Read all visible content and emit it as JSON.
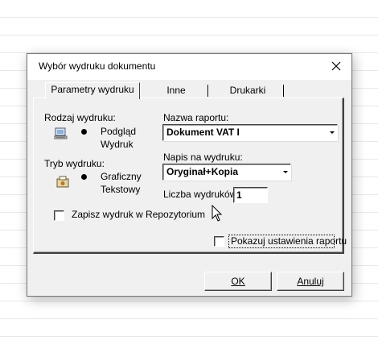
{
  "window": {
    "title": "Wybór wydruku dokumentu"
  },
  "tabs": [
    {
      "label": "Parametry wydruku",
      "active": true
    },
    {
      "label": "Inne",
      "active": false
    },
    {
      "label": "Drukarki",
      "active": false
    }
  ],
  "print_type": {
    "label": "Rodzaj wydruku:",
    "options": [
      {
        "label": "Podgląd",
        "selected": true
      },
      {
        "label": "Wydruk",
        "selected": false
      }
    ]
  },
  "print_mode": {
    "label": "Tryb wydruku:",
    "options": [
      {
        "label": "Graficzny",
        "selected": true
      },
      {
        "label": "Tekstowy",
        "selected": false
      }
    ]
  },
  "report_name": {
    "label": "Nazwa raportu:",
    "value": "Dokument VAT I"
  },
  "caption": {
    "label": "Napis na wydruku:",
    "value": "Oryginał+Kopia"
  },
  "copies": {
    "label": "Liczba wydruków:",
    "value": "1"
  },
  "save_repo": {
    "label": "Zapisz wydruk w Repozytorium",
    "checked": false
  },
  "show_settings": {
    "label": "Pokazuj ustawienia raportu",
    "checked": false
  },
  "buttons": {
    "ok": "OK",
    "cancel": "Anuluj"
  },
  "icons": {
    "close": "close-icon",
    "preview": "monitor-icon",
    "graphic": "printer-graphic-icon",
    "cursor": "mouse-pointer-icon"
  }
}
